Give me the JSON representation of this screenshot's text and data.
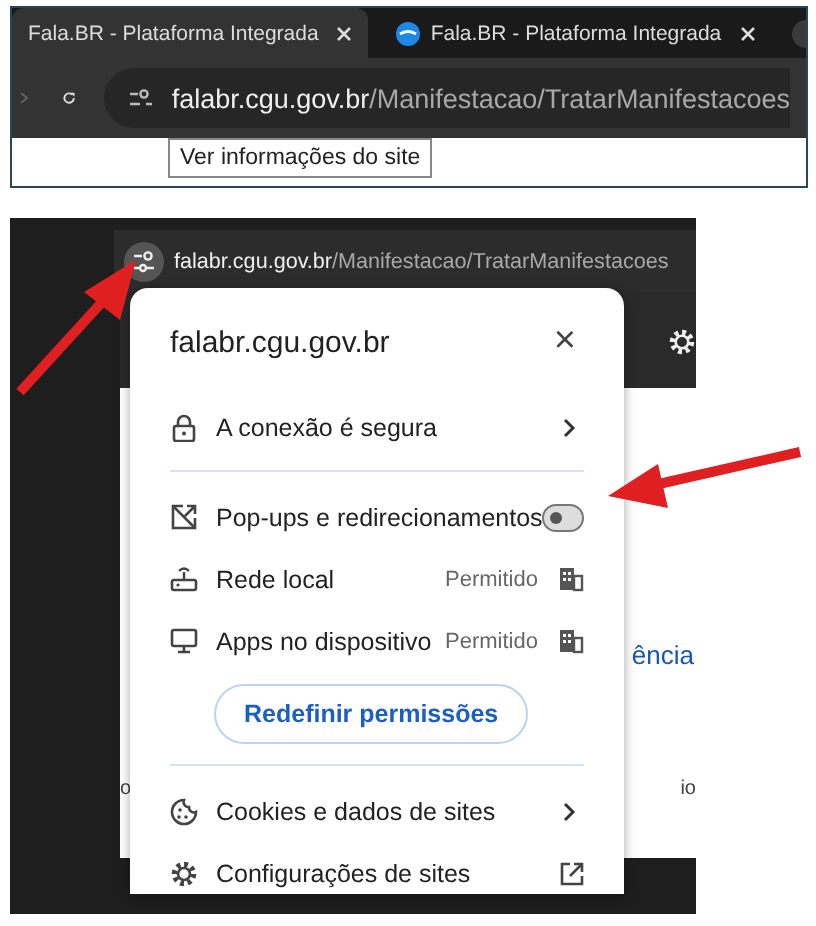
{
  "browser": {
    "tabs": [
      {
        "title": "Fala.BR - Plataforma Integrada",
        "selected": true
      },
      {
        "title": "Fala.BR - Plataforma Integrada",
        "selected": false
      }
    ],
    "address": {
      "host": "falabr.cgu.gov.br",
      "path": "/Manifestacao/TratarManifestacoes"
    },
    "tooltip": "Ver informações do site"
  },
  "zoomed": {
    "address": {
      "host": "falabr.cgu.gov.br",
      "path": "/Manifestacao/TratarManifestacoes"
    },
    "page_fragments": [
      "ência",
      "o",
      "io"
    ],
    "site_info": {
      "title": "falabr.cgu.gov.br",
      "close": "×",
      "connection": "A conexão é segura",
      "permissions": [
        {
          "kind": "toggle",
          "label": "Pop-ups e redirecionamentos",
          "on": false
        },
        {
          "kind": "status",
          "label": "Rede local",
          "status": "Permitido"
        },
        {
          "kind": "status",
          "label": "Apps no dispositivo",
          "status": "Permitido"
        }
      ],
      "reset_button": "Redefinir permissões",
      "links": [
        {
          "kind": "submenu",
          "label": "Cookies e dados de sites"
        },
        {
          "kind": "external",
          "label": "Configurações de sites"
        }
      ]
    }
  }
}
